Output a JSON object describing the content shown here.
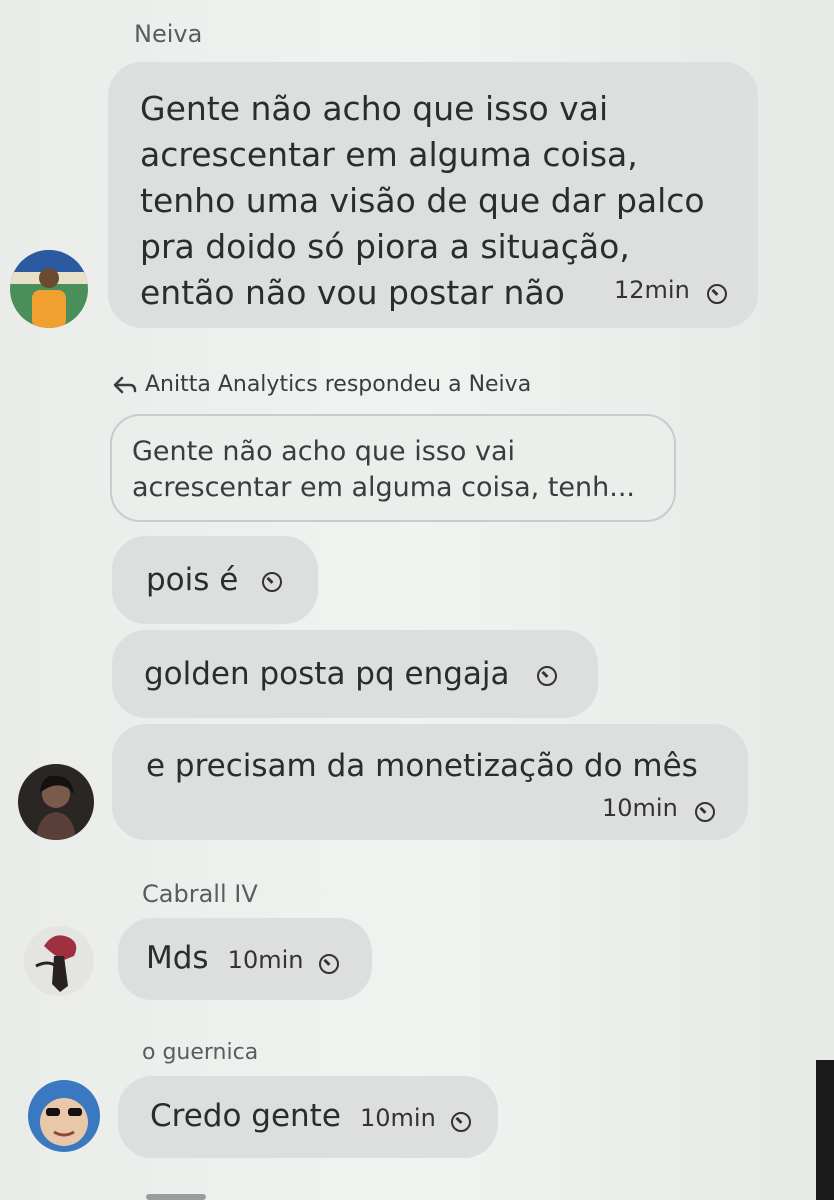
{
  "messages": {
    "m1": {
      "sender": "Neiva",
      "lines": [
        "Gente não acho que isso vai",
        "acrescentar em alguma coisa,",
        "tenho uma visão de que dar palco",
        "pra doido só piora a situação,",
        "então não vou postar não"
      ],
      "time": "12min"
    },
    "reply": {
      "header": "Anitta Analytics respondeu a Neiva",
      "quote_lines": [
        "Gente não acho que isso vai",
        "acrescentar em alguma coisa, tenh..."
      ]
    },
    "m2": {
      "text": "pois é"
    },
    "m3": {
      "text": "golden posta pq engaja"
    },
    "m4": {
      "text": "e precisam da monetização do mês",
      "time": "10min"
    },
    "m5": {
      "sender": "Cabrall IV",
      "text": "Mds",
      "time": "10min"
    },
    "m6": {
      "sender": "o guernica",
      "text": "Credo gente",
      "time": "10min"
    }
  },
  "icons": {
    "clock": "clock-icon",
    "reply": "reply-arrow-icon"
  },
  "colors": {
    "bubble": "#dcdfdd",
    "background": "#eef0ee",
    "text": "#2a2d2c"
  }
}
